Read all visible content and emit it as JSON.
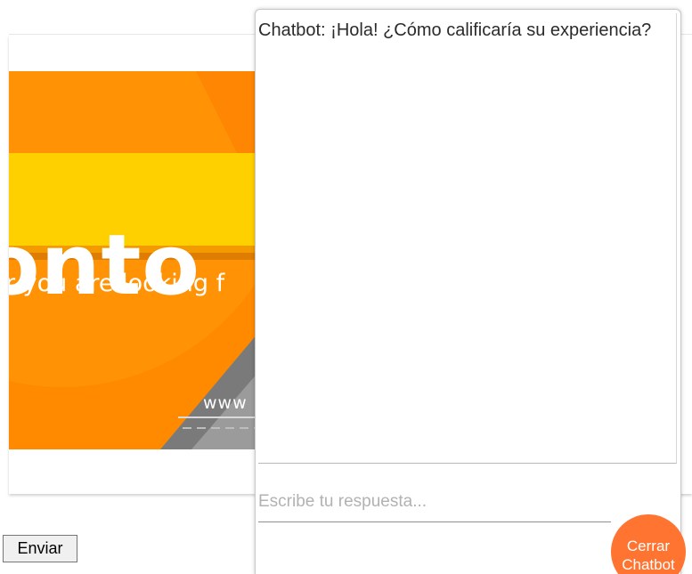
{
  "banner": {
    "logo_text": "onto",
    "tagline": "r you are looking f",
    "url_fragment": "www"
  },
  "chatbot": {
    "message": "Chatbot: ¡Hola! ¿Cómo calificaría su experiencia?",
    "reply_placeholder": "Escribe tu respuesta...",
    "send_label": "Enviar",
    "close_label_line1": "Cerrar",
    "close_label_line2": "Chatbot"
  },
  "colors": {
    "banner_orange": "#ff8a00",
    "banner_yellow": "#ffd000",
    "close_button": "#ff7430"
  }
}
